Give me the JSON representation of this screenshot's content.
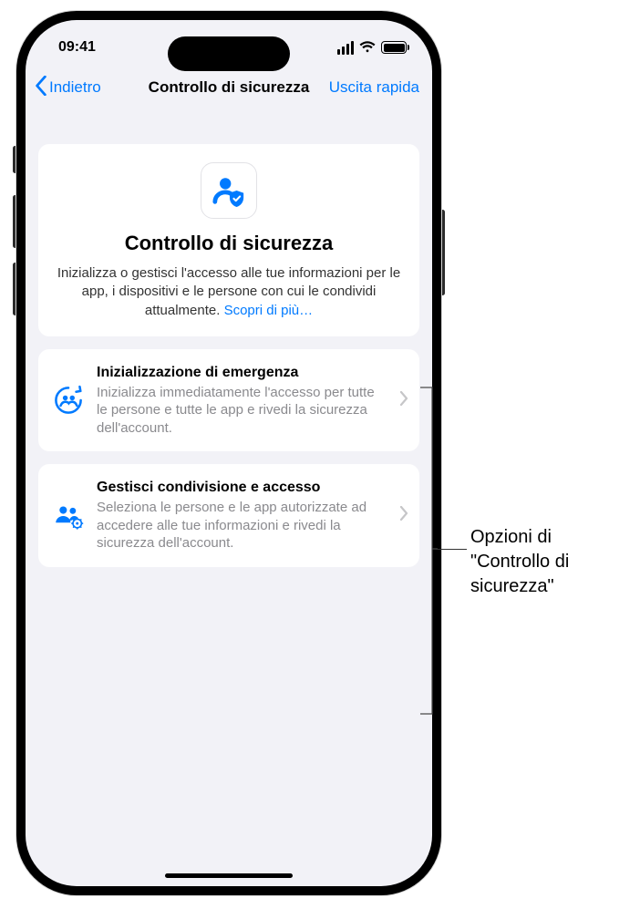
{
  "status": {
    "time": "09:41"
  },
  "nav": {
    "back": "Indietro",
    "title": "Controllo di sicurezza",
    "quick_exit": "Uscita rapida"
  },
  "hero": {
    "title": "Controllo di sicurezza",
    "description": "Inizializza o gestisci l'accesso alle tue informazioni per le app, i dispositivi e le persone con cui le condividi attualmente. ",
    "learn_more": "Scopri di più…"
  },
  "options": {
    "emergency": {
      "title": "Inizializzazione di emergenza",
      "description": "Inizializza immediatamente l'accesso per tutte le persone e tutte le app e rivedi la sicurezza dell'account."
    },
    "manage": {
      "title": "Gestisci condivisione e accesso",
      "description": "Seleziona le persone e le app autorizzate ad accedere alle tue informazioni e rivedi la sicurezza dell'account."
    }
  },
  "callout": {
    "text": "Opzioni di \"Controllo di sicurezza\""
  }
}
